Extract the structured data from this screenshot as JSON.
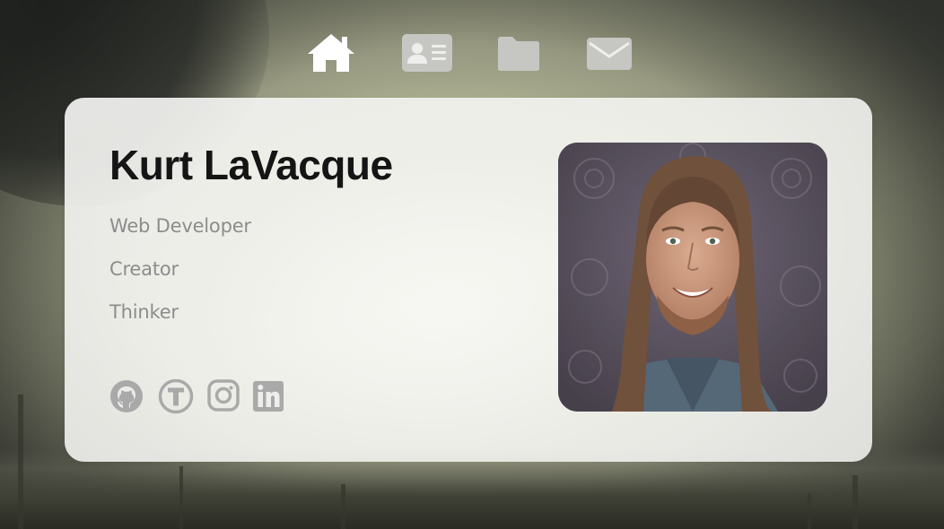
{
  "nav": {
    "items": [
      {
        "icon": "home-icon",
        "active": true
      },
      {
        "icon": "contact-card-icon",
        "active": false
      },
      {
        "icon": "folder-icon",
        "active": false
      },
      {
        "icon": "envelope-icon",
        "active": false
      }
    ]
  },
  "profile": {
    "name": "Kurt LaVacque",
    "roles": [
      "Web Developer",
      "Creator",
      "Thinker"
    ],
    "socials": [
      {
        "icon": "github-icon"
      },
      {
        "icon": "t-circle-icon"
      },
      {
        "icon": "instagram-icon"
      },
      {
        "icon": "linkedin-icon"
      }
    ]
  },
  "colors": {
    "active_nav": "#ffffff",
    "inactive_nav": "#c6c6c3",
    "name_text": "#151515",
    "role_text": "#8c8c8c",
    "social_icon": "#a9a9a9"
  }
}
